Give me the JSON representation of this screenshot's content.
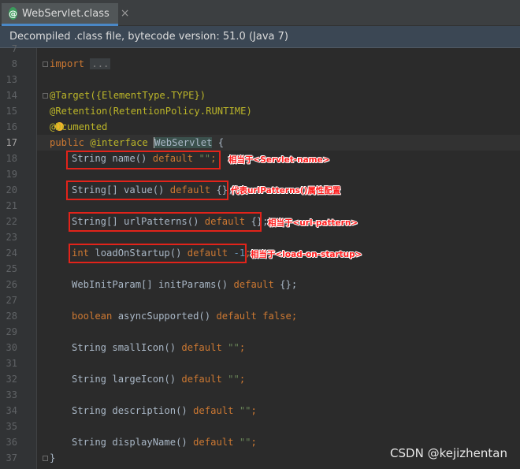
{
  "tab": {
    "icon": "@",
    "title": "WebServlet.class",
    "close": "×"
  },
  "banner": {
    "text": "Decompiled .class file, bytecode version: 51.0 (Java 7)"
  },
  "lines": [
    {
      "n": "8",
      "k": "l8"
    },
    {
      "n": "13",
      "k": "l13"
    },
    {
      "n": "14",
      "k": "l14"
    },
    {
      "n": "15",
      "k": "l15"
    },
    {
      "n": "16",
      "k": "l16"
    },
    {
      "n": "17",
      "k": "l17"
    },
    {
      "n": "18"
    },
    {
      "n": "19"
    },
    {
      "n": "20"
    },
    {
      "n": "21"
    },
    {
      "n": "22"
    },
    {
      "n": "23"
    },
    {
      "n": "24"
    },
    {
      "n": "25"
    },
    {
      "n": "26"
    },
    {
      "n": "27"
    },
    {
      "n": "28"
    },
    {
      "n": "29"
    },
    {
      "n": "30"
    },
    {
      "n": "31"
    },
    {
      "n": "32"
    },
    {
      "n": "33"
    },
    {
      "n": "34"
    },
    {
      "n": "35"
    },
    {
      "n": "36"
    },
    {
      "n": "37"
    }
  ],
  "code": {
    "import_kw": "import",
    "import_fold": "...",
    "target": "@Target({ElementType.TYPE})",
    "retention": "@Retention(RetentionPolicy.RUNTIME)",
    "documented_a": "@D",
    "documented_b": "cumented",
    "decl_public": "public",
    "decl_interface": "@interface",
    "decl_name": "WebServlet",
    "decl_brace": " {",
    "name_type": "String name() ",
    "default": "default",
    "empty_str": "\"\"",
    "semi": ";",
    "value_decl": "String[] value() ",
    "arr_default": " {};",
    "url_decl": "String[] urlPatterns() ",
    "int_kw": "int",
    "los_decl": " loadOnStartup() ",
    "los_val": " -1",
    "init_decl": "WebInitParam[] initParams() ",
    "bool_kw": "boolean",
    "async_decl": " asyncSupported() ",
    "false_kw": " false",
    "small_decl": "String smallIcon() ",
    "large_decl": "String largeIcon() ",
    "desc_decl": "String description() ",
    "disp_decl": "String displayName() ",
    "close_brace": "}"
  },
  "notes": {
    "servlet_name": "相当于<Servlet-name>",
    "value": "代表urlPatterns()属性配置",
    "url_pattern": "相当于<url-pattern>",
    "load_on_startup": "相当于<load-on-startup>"
  },
  "watermark": "CSDN @kejizhentan"
}
